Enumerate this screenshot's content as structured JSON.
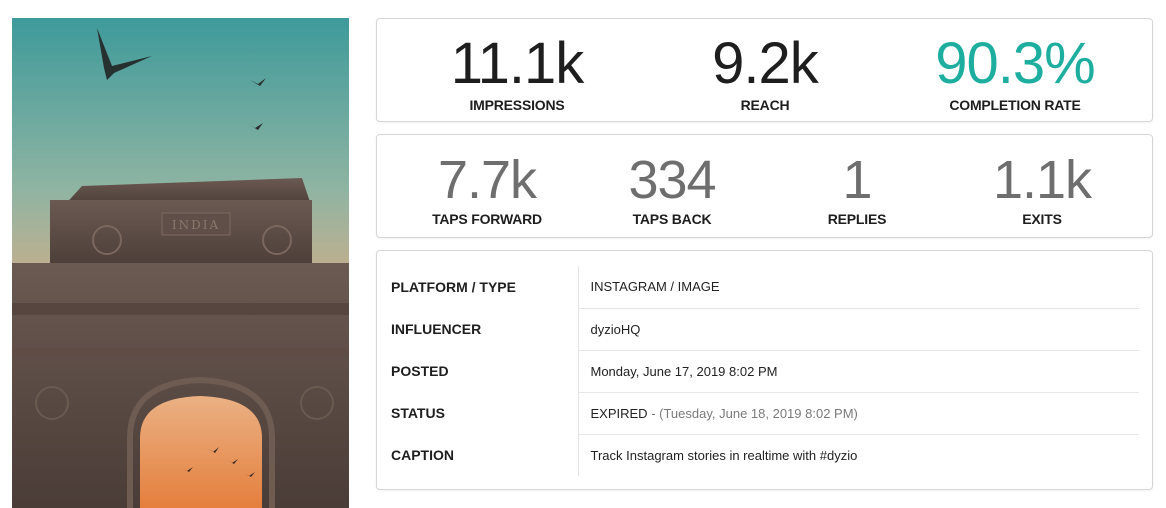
{
  "image": {
    "alt": "Story image of India Gate at sunset with birds",
    "engraving": "INDIA",
    "colors": {
      "sky_top": "#3f9a9b",
      "sky_mid": "#a4b8a2",
      "sky_low": "#e7a77c",
      "stone": "#5a4a44",
      "arch_glow": "#e9955e"
    }
  },
  "primary_stats": [
    {
      "value": "11.1k",
      "label": "IMPRESSIONS",
      "color": "#1e1e1e"
    },
    {
      "value": "9.2k",
      "label": "REACH",
      "color": "#1e1e1e"
    },
    {
      "value": "90.3%",
      "label": "COMPLETION RATE",
      "color": "#1eaea0"
    }
  ],
  "secondary_stats": [
    {
      "value": "7.7k",
      "label": "TAPS FORWARD"
    },
    {
      "value": "334",
      "label": "TAPS BACK"
    },
    {
      "value": "1",
      "label": "REPLIES"
    },
    {
      "value": "1.1k",
      "label": "EXITS"
    }
  ],
  "details": {
    "platform": {
      "key": "PLATFORM / TYPE",
      "value": "INSTAGRAM / IMAGE"
    },
    "influencer": {
      "key": "INFLUENCER",
      "value": "dyzioHQ"
    },
    "posted": {
      "key": "POSTED",
      "value": "Monday, June 17, 2019 8:02 PM"
    },
    "status": {
      "key": "STATUS",
      "value": "EXPIRED",
      "sep": " - ",
      "expiry": "(Tuesday, June 18, 2019 8:02 PM)"
    },
    "caption": {
      "key": "CAPTION",
      "value": "Track Instagram stories in realtime with #dyzio"
    }
  }
}
